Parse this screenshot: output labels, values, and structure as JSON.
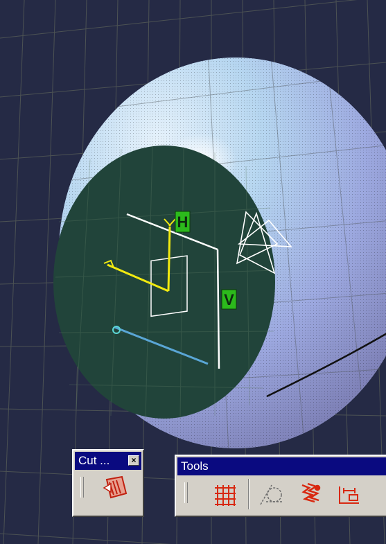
{
  "toolbars": {
    "cut": {
      "title": "Cut ...",
      "close_glyph": "×"
    },
    "tools": {
      "title": "Tools"
    }
  },
  "icons": {
    "cut_part": "cut-part-by-plane-icon",
    "grid": "sketch-grid-icon",
    "construction": "construction-element-icon",
    "snap": "snap-to-point-icon",
    "dimension": "dimensional-constraint-icon"
  },
  "axis_labels": {
    "h": "H",
    "v": "V"
  },
  "colors": {
    "viewport": "#252a45",
    "sphere": "#aab4e0",
    "sketch_plane": "#21443a",
    "axis_yellow": "#f2ea10",
    "label_green": "#2cba1c",
    "toolbar_face": "#d4d0c8",
    "titlebar": "#0a0a80",
    "icon_red": "#d82810"
  }
}
